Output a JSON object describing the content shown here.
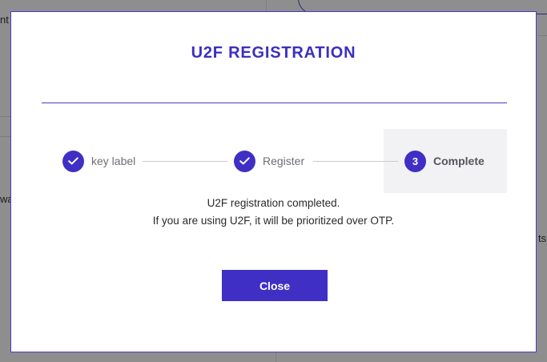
{
  "background": {
    "text_top_left": "nt",
    "text_mid_left": "wa",
    "text_mid_right": "ts"
  },
  "modal": {
    "title": "U2F REGISTRATION",
    "steps": [
      {
        "label": "key label",
        "status": "completed",
        "icon": "check-icon"
      },
      {
        "label": "Register",
        "status": "completed",
        "icon": "check-icon"
      },
      {
        "label": "Complete",
        "status": "current",
        "number": "3"
      }
    ],
    "message_line1": "U2F registration completed.",
    "message_line2": "If you are using U2F, it will be prioritized over OTP.",
    "close_label": "Close"
  },
  "colors": {
    "accent": "#3f2fc5",
    "title": "#3a2fc0",
    "current_step_bg": "#f2f2f4"
  }
}
